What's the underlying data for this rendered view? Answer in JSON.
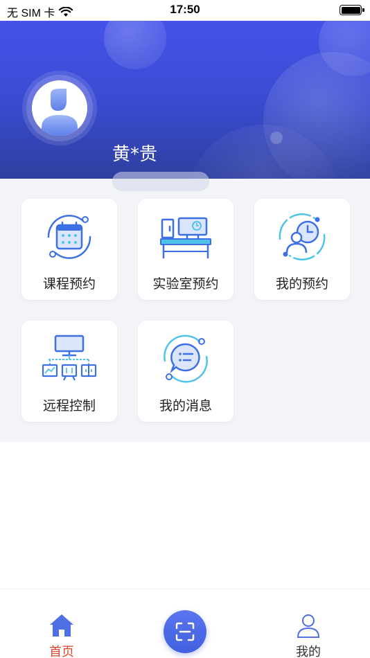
{
  "status_bar": {
    "carrier": "无 SIM 卡",
    "time": "17:50"
  },
  "profile": {
    "name": "黄*贵"
  },
  "menu": [
    {
      "label": "课程预约",
      "icon": "calendar-icon"
    },
    {
      "label": "实验室预约",
      "icon": "lab-desk-icon"
    },
    {
      "label": "我的预约",
      "icon": "user-clock-icon"
    },
    {
      "label": "远程控制",
      "icon": "remote-network-icon"
    },
    {
      "label": "我的消息",
      "icon": "message-bubble-icon"
    }
  ],
  "nav": {
    "home": "首页",
    "me": "我的"
  },
  "colors": {
    "header_start": "#4553e9",
    "header_end": "#2e3f9f",
    "accent": "#4260df",
    "active_tab": "#e0452d",
    "icon_blue": "#3d70e6",
    "icon_cyan": "#4fc3e8"
  }
}
